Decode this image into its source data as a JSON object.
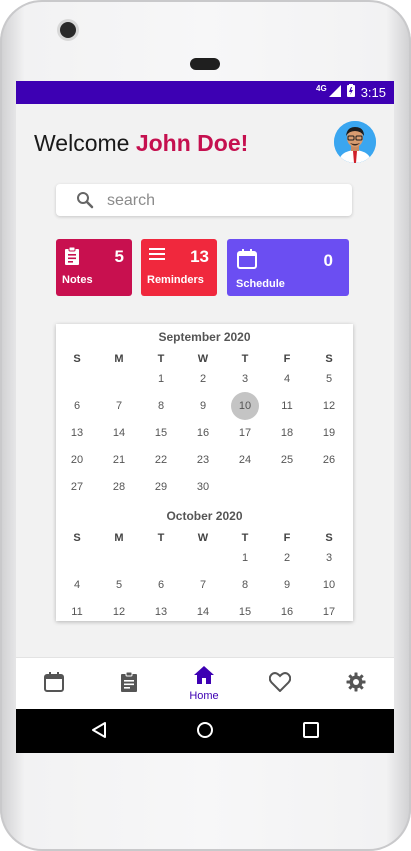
{
  "status": {
    "network": "4G",
    "time": "3:15"
  },
  "header": {
    "welcome": "Welcome",
    "user_name": "John Doe!"
  },
  "search": {
    "placeholder": "search"
  },
  "cards": [
    {
      "label": "Notes",
      "count": "5",
      "color": "#c8104f",
      "icon": "clipboard-icon"
    },
    {
      "label": "Reminders",
      "count": "13",
      "color": "#f0283d",
      "icon": "menu-icon"
    },
    {
      "label": "Schedule",
      "count": "0",
      "color": "#6b4ef2",
      "icon": "calendar-icon"
    }
  ],
  "calendar": {
    "weekdays": [
      "S",
      "M",
      "T",
      "W",
      "T",
      "F",
      "S"
    ],
    "selected_day": "10",
    "months": [
      {
        "title": "September 2020",
        "weeks": [
          [
            "",
            "",
            "1",
            "2",
            "3",
            "4",
            "5"
          ],
          [
            "6",
            "7",
            "8",
            "9",
            "10",
            "11",
            "12"
          ],
          [
            "13",
            "14",
            "15",
            "16",
            "17",
            "18",
            "19"
          ],
          [
            "20",
            "21",
            "22",
            "23",
            "24",
            "25",
            "26"
          ],
          [
            "27",
            "28",
            "29",
            "30",
            "",
            "",
            ""
          ]
        ]
      },
      {
        "title": "October 2020",
        "weeks": [
          [
            "",
            "",
            "",
            "",
            "1",
            "2",
            "3"
          ],
          [
            "4",
            "5",
            "6",
            "7",
            "8",
            "9",
            "10"
          ],
          [
            "11",
            "12",
            "13",
            "14",
            "15",
            "16",
            "17"
          ]
        ]
      }
    ]
  },
  "bottom_nav": [
    {
      "icon": "calendar-icon",
      "label": ""
    },
    {
      "icon": "clipboard-icon",
      "label": ""
    },
    {
      "icon": "home-icon",
      "label": "Home",
      "active": true
    },
    {
      "icon": "heart-icon",
      "label": ""
    },
    {
      "icon": "gear-icon",
      "label": ""
    }
  ],
  "colors": {
    "accent": "#3d00b3",
    "name": "#c5104f"
  }
}
